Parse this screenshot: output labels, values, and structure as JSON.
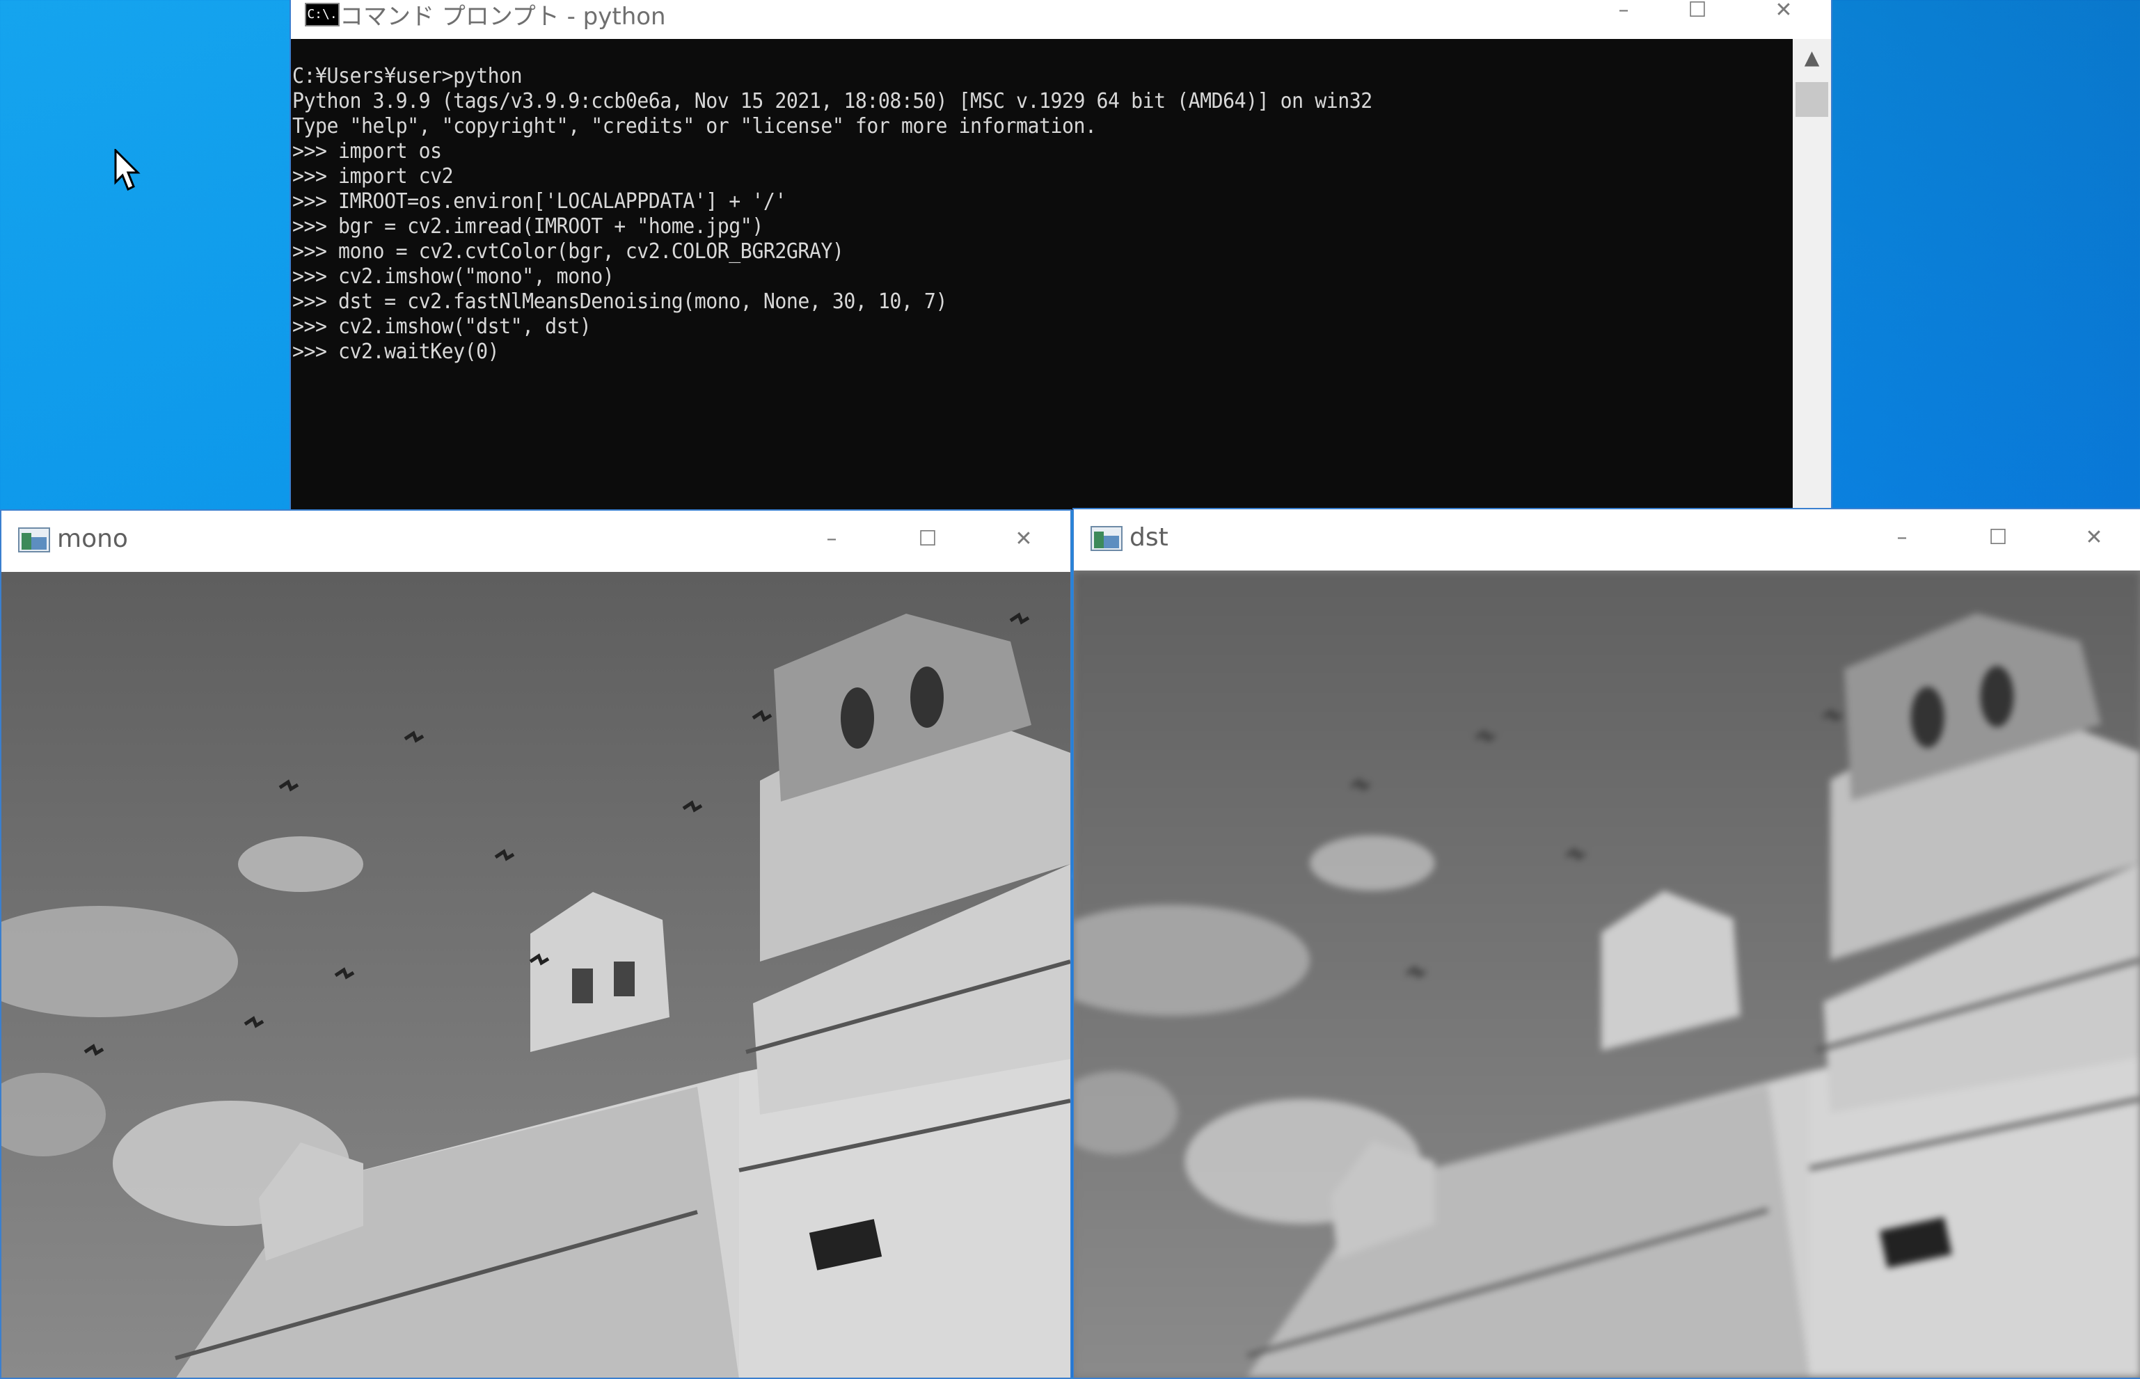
{
  "desktop": {
    "accent": "#0d97ea"
  },
  "cmd_window": {
    "title": "コマンド プロンプト - python",
    "icon": "cmd-icon",
    "icon_text": "C:\\.",
    "buttons": {
      "minimize": "–",
      "maximize": "☐",
      "close": "✕"
    },
    "lines": [
      "C:¥Users¥user>python",
      "Python 3.9.9 (tags/v3.9.9:ccb0e6a, Nov 15 2021, 18:08:50) [MSC v.1929 64 bit (AMD64)] on win32",
      "Type \"help\", \"copyright\", \"credits\" or \"license\" for more information.",
      ">>> import os",
      ">>> import cv2",
      ">>> IMROOT=os.environ['LOCALAPPDATA'] + '/'",
      ">>> bgr = cv2.imread(IMROOT + \"home.jpg\")",
      ">>> mono = cv2.cvtColor(bgr, cv2.COLOR_BGR2GRAY)",
      ">>> cv2.imshow(\"mono\", mono)",
      ">>> dst = cv2.fastNlMeansDenoising(mono, None, 30, 10, 7)",
      ">>> cv2.imshow(\"dst\", dst)",
      ">>> cv2.waitKey(0)"
    ],
    "scroll_up_icon": "▲"
  },
  "mono_window": {
    "title": "mono",
    "icon": "opencv-window-icon",
    "buttons": {
      "minimize": "–",
      "maximize": "☐",
      "close": "✕"
    }
  },
  "dst_window": {
    "title": "dst",
    "icon": "opencv-window-icon",
    "buttons": {
      "minimize": "–",
      "maximize": "☐",
      "close": "✕"
    }
  }
}
